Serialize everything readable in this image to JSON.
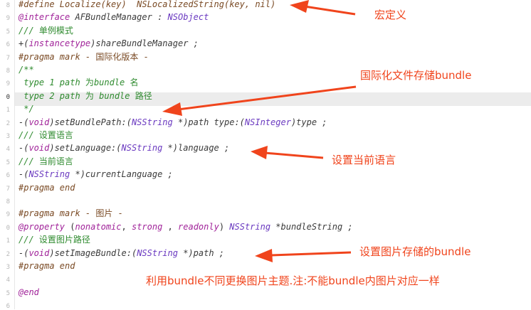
{
  "editor": {
    "line_numbers": [
      "8",
      "9",
      "5",
      "6",
      "7",
      "8",
      "9",
      "0",
      "1",
      "2",
      "3",
      "4",
      "5",
      "6",
      "7",
      "8",
      "9",
      "0",
      "1",
      "2",
      "3",
      "4",
      "5",
      "6"
    ],
    "selected_line_index": 7,
    "lines": [
      [
        {
          "t": "#define Localize(key)  NSLocalizedString(key, nil)",
          "c": "pre"
        }
      ],
      [
        {
          "t": "@interface",
          "c": "kw"
        },
        {
          "t": " AFBundleManager : ",
          "c": "code"
        },
        {
          "t": "NSObject",
          "c": "type"
        }
      ],
      [
        {
          "t": "/// ",
          "c": "com"
        },
        {
          "t": "单例模式",
          "c": "comzh"
        }
      ],
      [
        {
          "t": "+(",
          "c": "code"
        },
        {
          "t": "instancetype",
          "c": "kw"
        },
        {
          "t": ")shareBundleManager ;",
          "c": "code"
        }
      ],
      [
        {
          "t": "#pragma mark - ",
          "c": "pre"
        },
        {
          "t": "国际化版本",
          "c": "prezh"
        },
        {
          "t": " -",
          "c": "pre"
        }
      ],
      [
        {
          "t": "/**",
          "c": "com"
        }
      ],
      [
        {
          "t": " type 1 path ",
          "c": "com"
        },
        {
          "t": "为",
          "c": "comzh"
        },
        {
          "t": "bundle ",
          "c": "com"
        },
        {
          "t": "名",
          "c": "comzh"
        }
      ],
      [
        {
          "t": " type 2 path ",
          "c": "com"
        },
        {
          "t": "为",
          "c": "comzh"
        },
        {
          "t": " bundle ",
          "c": "com"
        },
        {
          "t": "路径",
          "c": "comzh"
        }
      ],
      [
        {
          "t": " */",
          "c": "com"
        }
      ],
      [
        {
          "t": "-(",
          "c": "code"
        },
        {
          "t": "void",
          "c": "kw"
        },
        {
          "t": ")setBundlePath:(",
          "c": "code"
        },
        {
          "t": "NSString",
          "c": "type"
        },
        {
          "t": " *)path type:(",
          "c": "code"
        },
        {
          "t": "NSInteger",
          "c": "type"
        },
        {
          "t": ")type ;",
          "c": "code"
        }
      ],
      [
        {
          "t": "/// ",
          "c": "com"
        },
        {
          "t": "设置语言",
          "c": "comzh"
        }
      ],
      [
        {
          "t": "-(",
          "c": "code"
        },
        {
          "t": "void",
          "c": "kw"
        },
        {
          "t": ")setLanguage:(",
          "c": "code"
        },
        {
          "t": "NSString",
          "c": "type"
        },
        {
          "t": " *)language ;",
          "c": "code"
        }
      ],
      [
        {
          "t": "/// ",
          "c": "com"
        },
        {
          "t": "当前语言",
          "c": "comzh"
        }
      ],
      [
        {
          "t": "-(",
          "c": "code"
        },
        {
          "t": "NSString",
          "c": "type"
        },
        {
          "t": " *)currentLanguage ;",
          "c": "code"
        }
      ],
      [
        {
          "t": "#pragma end",
          "c": "pre"
        }
      ],
      [],
      [
        {
          "t": "#pragma mark - ",
          "c": "pre"
        },
        {
          "t": "图片",
          "c": "prezh"
        },
        {
          "t": " -",
          "c": "pre"
        }
      ],
      [
        {
          "t": "@property",
          "c": "kw"
        },
        {
          "t": " (",
          "c": "pn"
        },
        {
          "t": "nonatomic",
          "c": "kw"
        },
        {
          "t": ", ",
          "c": "pn"
        },
        {
          "t": "strong",
          "c": "kw"
        },
        {
          "t": " , ",
          "c": "pn"
        },
        {
          "t": "readonly",
          "c": "kw"
        },
        {
          "t": ") ",
          "c": "pn"
        },
        {
          "t": "NSString",
          "c": "type"
        },
        {
          "t": " *bundleString ;",
          "c": "code"
        }
      ],
      [
        {
          "t": "/// ",
          "c": "com"
        },
        {
          "t": "设置图片路径",
          "c": "comzh"
        }
      ],
      [
        {
          "t": "-(",
          "c": "code"
        },
        {
          "t": "void",
          "c": "kw"
        },
        {
          "t": ")setImageBundle:(",
          "c": "code"
        },
        {
          "t": "NSString",
          "c": "type"
        },
        {
          "t": " *)path ;",
          "c": "code"
        }
      ],
      [
        {
          "t": "#pragma end",
          "c": "pre"
        }
      ],
      [],
      [
        {
          "t": "@end",
          "c": "kw"
        }
      ],
      []
    ]
  },
  "annotations": {
    "macro": "宏定义",
    "i18n_bundle": "国际化文件存储bundle",
    "set_language": "设置当前语言",
    "set_image_bundle": "设置图片存储的bundle",
    "theme_note": "利用bundle不同更换图片主题.注:不能bundle内图片对应一样"
  },
  "colors": {
    "annotation": "#f0441c",
    "keyword": "#a1249a",
    "type": "#6a39c0",
    "comment": "#2f8b2f",
    "preprocessor": "#7a4a24"
  }
}
